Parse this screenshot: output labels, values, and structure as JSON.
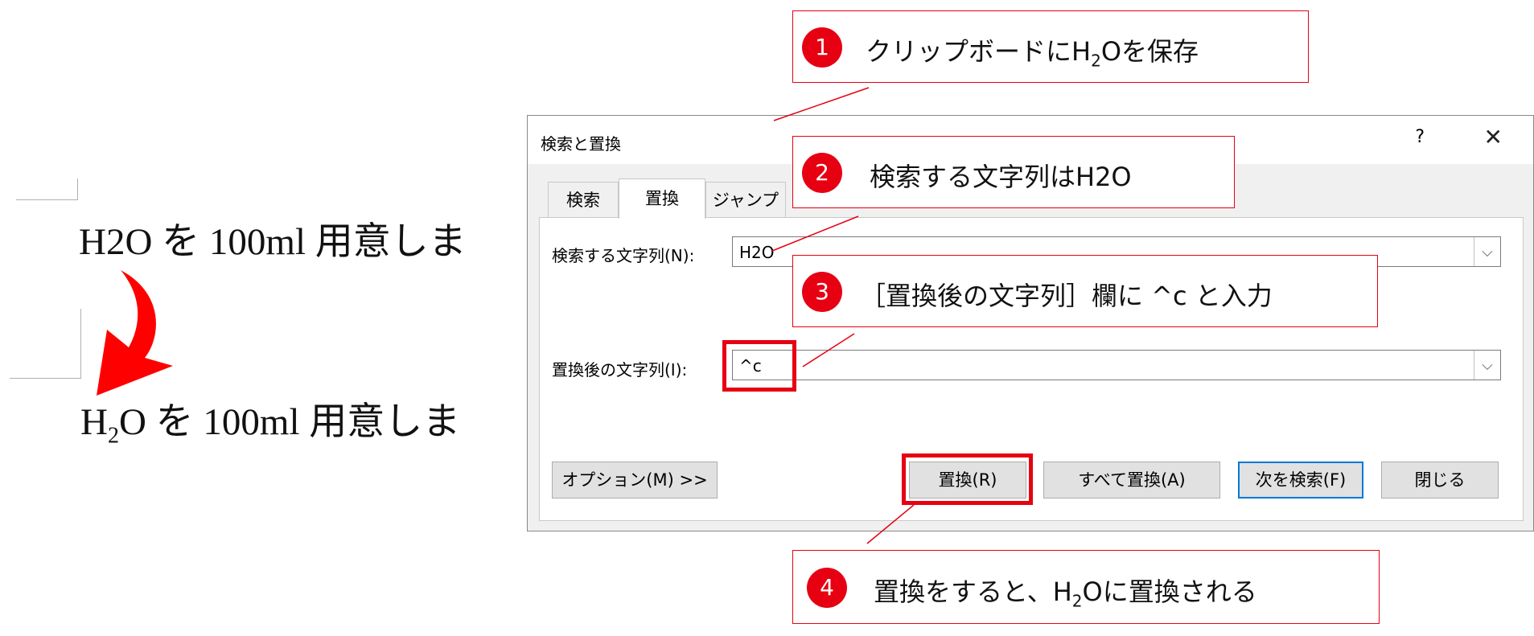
{
  "document": {
    "line1": "H2O を 100ml 用意しま",
    "line2_prefix": "H",
    "line2_sub": "2",
    "line2_suffix": "O を 100ml 用意しま"
  },
  "dialog": {
    "title": "検索と置換",
    "help_label": "?",
    "close_label": "✕",
    "tabs": [
      {
        "label": "検索",
        "active": false
      },
      {
        "label": "置換",
        "active": true
      },
      {
        "label": "ジャンプ",
        "active": false
      }
    ],
    "find_label": "検索する文字列(N):",
    "find_value": "H2O",
    "replace_label": "置換後の文字列(I):",
    "replace_value": "^c",
    "buttons": {
      "options": "オプション(M) >>",
      "replace": "置換(R)",
      "replace_all": "すべて置換(A)",
      "find_next": "次を検索(F)",
      "close": "閉じる"
    }
  },
  "callouts": [
    {
      "num": "1",
      "text_pre": "クリップボードにH",
      "text_sub": "2",
      "text_post": "Oを保存"
    },
    {
      "num": "2",
      "text": "検索する文字列はH2O"
    },
    {
      "num": "3",
      "text": "［置換後の文字列］欄に ^c と入力"
    },
    {
      "num": "4",
      "text_pre": "置換をすると、H",
      "text_sub": "2",
      "text_post": "Oに置換される"
    }
  ],
  "colors": {
    "accent_red": "#e60012",
    "focus_blue": "#0078d7",
    "dialog_bg": "#f0f0f0"
  }
}
